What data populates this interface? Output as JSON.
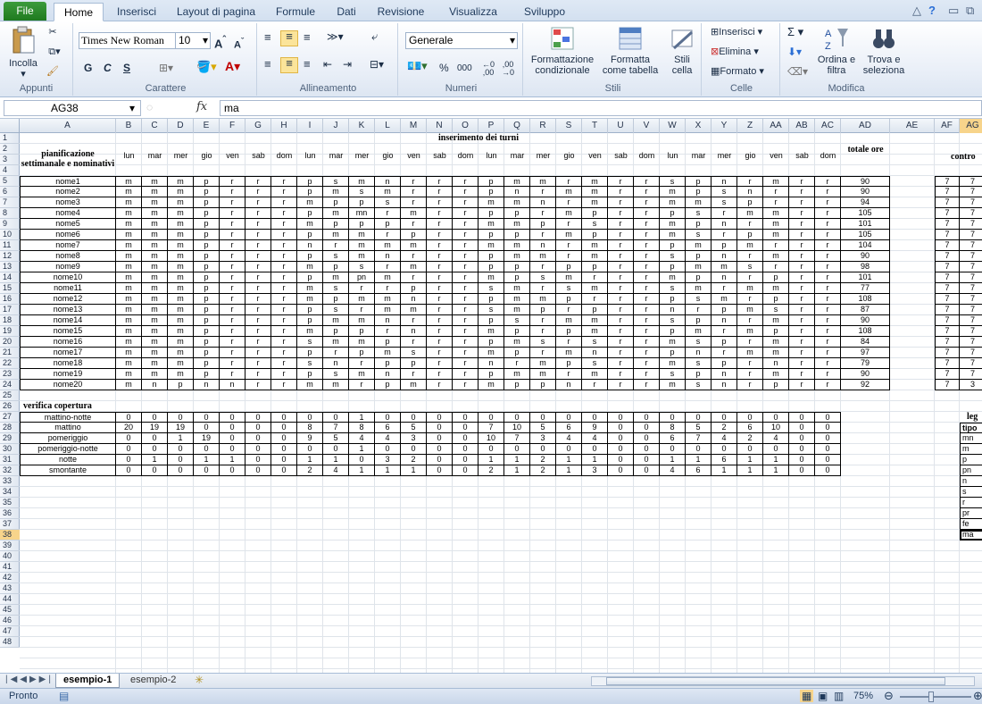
{
  "tabs": [
    "File",
    "Home",
    "Inserisci",
    "Layout di pagina",
    "Formule",
    "Dati",
    "Revisione",
    "Visualizza",
    "Sviluppo"
  ],
  "active_tab": "Home",
  "ribbon": {
    "clipboard": {
      "label": "Appunti",
      "paste": "Incolla"
    },
    "font": {
      "label": "Carattere",
      "family": "Times New Roman",
      "size": "10",
      "bold": "G",
      "italic": "C",
      "underline": "S"
    },
    "alignment": {
      "label": "Allineamento"
    },
    "number": {
      "label": "Numeri",
      "format": "Generale",
      "percent": "%",
      "thousands": "000"
    },
    "styles": {
      "label": "Stili",
      "cond_format": "Formattazione condizionale",
      "table": "Formatta come tabella",
      "cell_styles": "Stili cella"
    },
    "cells": {
      "label": "Celle",
      "insert": "Inserisci",
      "delete": "Elimina",
      "format": "Formato"
    },
    "editing": {
      "label": "Modifica",
      "sort": "Ordina e filtra",
      "find": "Trova e seleziona",
      "sum": "Σ"
    }
  },
  "formula_bar": {
    "name_box": "AG38",
    "fx": "fx",
    "value": "ma"
  },
  "columns": [
    "A",
    "B",
    "C",
    "D",
    "E",
    "F",
    "G",
    "H",
    "I",
    "J",
    "K",
    "L",
    "M",
    "N",
    "O",
    "P",
    "Q",
    "R",
    "S",
    "T",
    "U",
    "V",
    "W",
    "X",
    "Y",
    "Z",
    "AA",
    "AB",
    "AC",
    "AD",
    "AE",
    "AF",
    "AG"
  ],
  "selected_col": "AG",
  "selected_row": 38,
  "row_count": 48,
  "sheet": {
    "top_header": "inserimento dei turni",
    "planning_header": "pianificazione settimanale e nominativi",
    "total_header": "totale ore",
    "control_header": "contro",
    "days": [
      "lun",
      "mar",
      "mer",
      "gio",
      "ven",
      "sab",
      "dom",
      "lun",
      "mar",
      "mer",
      "gio",
      "ven",
      "sab",
      "dom",
      "lun",
      "mar",
      "mer",
      "gio",
      "ven",
      "sab",
      "dom",
      "lun",
      "mar",
      "mer",
      "gio",
      "ven",
      "sab",
      "dom"
    ],
    "people": [
      {
        "name": "nome1",
        "shifts": [
          "m",
          "m",
          "m",
          "p",
          "r",
          "r",
          "r",
          "p",
          "s",
          "m",
          "n",
          "r",
          "r",
          "r",
          "p",
          "m",
          "m",
          "r",
          "m",
          "r",
          "r",
          "s",
          "p",
          "n",
          "r",
          "m",
          "r",
          "r"
        ],
        "total": "90",
        "ctrl": [
          "7",
          "7"
        ]
      },
      {
        "name": "nome2",
        "shifts": [
          "m",
          "m",
          "m",
          "p",
          "r",
          "r",
          "r",
          "p",
          "m",
          "s",
          "m",
          "r",
          "r",
          "r",
          "p",
          "n",
          "r",
          "m",
          "m",
          "r",
          "r",
          "m",
          "p",
          "s",
          "n",
          "r",
          "r",
          "r"
        ],
        "total": "90",
        "ctrl": [
          "7",
          "7"
        ]
      },
      {
        "name": "nome3",
        "shifts": [
          "m",
          "m",
          "m",
          "p",
          "r",
          "r",
          "r",
          "m",
          "p",
          "p",
          "s",
          "r",
          "r",
          "r",
          "m",
          "m",
          "n",
          "r",
          "m",
          "r",
          "r",
          "m",
          "m",
          "s",
          "p",
          "r",
          "r",
          "r"
        ],
        "total": "94",
        "ctrl": [
          "7",
          "7"
        ]
      },
      {
        "name": "nome4",
        "shifts": [
          "m",
          "m",
          "m",
          "p",
          "r",
          "r",
          "r",
          "p",
          "m",
          "mn",
          "r",
          "m",
          "r",
          "r",
          "p",
          "p",
          "r",
          "m",
          "p",
          "r",
          "r",
          "p",
          "s",
          "r",
          "m",
          "m",
          "r",
          "r"
        ],
        "total": "105",
        "ctrl": [
          "7",
          "7"
        ]
      },
      {
        "name": "nome5",
        "shifts": [
          "m",
          "m",
          "m",
          "p",
          "r",
          "r",
          "r",
          "m",
          "p",
          "p",
          "p",
          "r",
          "r",
          "r",
          "m",
          "m",
          "p",
          "r",
          "s",
          "r",
          "r",
          "m",
          "p",
          "n",
          "r",
          "m",
          "r",
          "r"
        ],
        "total": "101",
        "ctrl": [
          "7",
          "7"
        ]
      },
      {
        "name": "nome6",
        "shifts": [
          "m",
          "m",
          "m",
          "p",
          "r",
          "r",
          "r",
          "p",
          "m",
          "m",
          "r",
          "p",
          "r",
          "r",
          "p",
          "p",
          "r",
          "m",
          "p",
          "r",
          "r",
          "m",
          "s",
          "r",
          "p",
          "m",
          "r",
          "r"
        ],
        "total": "105",
        "ctrl": [
          "7",
          "7"
        ]
      },
      {
        "name": "nome7",
        "shifts": [
          "m",
          "m",
          "m",
          "p",
          "r",
          "r",
          "r",
          "n",
          "r",
          "m",
          "m",
          "m",
          "r",
          "r",
          "m",
          "m",
          "n",
          "r",
          "m",
          "r",
          "r",
          "p",
          "m",
          "p",
          "m",
          "r",
          "r",
          "r"
        ],
        "total": "104",
        "ctrl": [
          "7",
          "7"
        ]
      },
      {
        "name": "nome8",
        "shifts": [
          "m",
          "m",
          "m",
          "p",
          "r",
          "r",
          "r",
          "p",
          "s",
          "m",
          "n",
          "r",
          "r",
          "r",
          "p",
          "m",
          "m",
          "r",
          "m",
          "r",
          "r",
          "s",
          "p",
          "n",
          "r",
          "m",
          "r",
          "r"
        ],
        "total": "90",
        "ctrl": [
          "7",
          "7"
        ]
      },
      {
        "name": "nome9",
        "shifts": [
          "m",
          "m",
          "m",
          "p",
          "r",
          "r",
          "r",
          "m",
          "p",
          "s",
          "r",
          "m",
          "r",
          "r",
          "p",
          "p",
          "r",
          "p",
          "p",
          "r",
          "r",
          "p",
          "m",
          "m",
          "s",
          "r",
          "r",
          "r"
        ],
        "total": "98",
        "ctrl": [
          "7",
          "7"
        ]
      },
      {
        "name": "nome10",
        "shifts": [
          "m",
          "m",
          "m",
          "p",
          "r",
          "r",
          "r",
          "p",
          "m",
          "pn",
          "m",
          "r",
          "r",
          "r",
          "m",
          "p",
          "s",
          "m",
          "r",
          "r",
          "r",
          "m",
          "p",
          "n",
          "r",
          "p",
          "r",
          "r"
        ],
        "total": "101",
        "ctrl": [
          "7",
          "7"
        ]
      },
      {
        "name": "nome11",
        "shifts": [
          "m",
          "m",
          "m",
          "p",
          "r",
          "r",
          "r",
          "m",
          "s",
          "r",
          "r",
          "p",
          "r",
          "r",
          "s",
          "m",
          "r",
          "s",
          "m",
          "r",
          "r",
          "s",
          "m",
          "r",
          "m",
          "m",
          "r",
          "r"
        ],
        "total": "77",
        "ctrl": [
          "7",
          "7"
        ]
      },
      {
        "name": "nome12",
        "shifts": [
          "m",
          "m",
          "m",
          "p",
          "r",
          "r",
          "r",
          "m",
          "p",
          "m",
          "m",
          "n",
          "r",
          "r",
          "p",
          "m",
          "m",
          "p",
          "r",
          "r",
          "r",
          "p",
          "s",
          "m",
          "r",
          "p",
          "r",
          "r"
        ],
        "total": "108",
        "ctrl": [
          "7",
          "7"
        ]
      },
      {
        "name": "nome13",
        "shifts": [
          "m",
          "m",
          "m",
          "p",
          "r",
          "r",
          "r",
          "p",
          "s",
          "r",
          "m",
          "m",
          "r",
          "r",
          "s",
          "m",
          "p",
          "r",
          "p",
          "r",
          "r",
          "n",
          "r",
          "p",
          "m",
          "s",
          "r",
          "r"
        ],
        "total": "87",
        "ctrl": [
          "7",
          "7"
        ]
      },
      {
        "name": "nome14",
        "shifts": [
          "m",
          "m",
          "m",
          "p",
          "r",
          "r",
          "r",
          "p",
          "m",
          "m",
          "n",
          "r",
          "r",
          "r",
          "p",
          "s",
          "r",
          "m",
          "m",
          "r",
          "r",
          "s",
          "p",
          "n",
          "r",
          "m",
          "r",
          "r"
        ],
        "total": "90",
        "ctrl": [
          "7",
          "7"
        ]
      },
      {
        "name": "nome15",
        "shifts": [
          "m",
          "m",
          "m",
          "p",
          "r",
          "r",
          "r",
          "m",
          "p",
          "p",
          "r",
          "n",
          "r",
          "r",
          "m",
          "p",
          "r",
          "p",
          "m",
          "r",
          "r",
          "p",
          "m",
          "r",
          "m",
          "p",
          "r",
          "r"
        ],
        "total": "108",
        "ctrl": [
          "7",
          "7"
        ]
      },
      {
        "name": "nome16",
        "shifts": [
          "m",
          "m",
          "m",
          "p",
          "r",
          "r",
          "r",
          "s",
          "m",
          "m",
          "p",
          "r",
          "r",
          "r",
          "p",
          "m",
          "s",
          "r",
          "s",
          "r",
          "r",
          "m",
          "s",
          "p",
          "r",
          "m",
          "r",
          "r"
        ],
        "total": "84",
        "ctrl": [
          "7",
          "7"
        ]
      },
      {
        "name": "nome17",
        "shifts": [
          "m",
          "m",
          "m",
          "p",
          "r",
          "r",
          "r",
          "p",
          "r",
          "p",
          "m",
          "s",
          "r",
          "r",
          "m",
          "p",
          "r",
          "m",
          "n",
          "r",
          "r",
          "p",
          "n",
          "r",
          "m",
          "m",
          "r",
          "r"
        ],
        "total": "97",
        "ctrl": [
          "7",
          "7"
        ]
      },
      {
        "name": "nome18",
        "shifts": [
          "m",
          "m",
          "m",
          "p",
          "r",
          "r",
          "r",
          "s",
          "n",
          "r",
          "p",
          "p",
          "r",
          "r",
          "n",
          "r",
          "m",
          "p",
          "s",
          "r",
          "r",
          "m",
          "s",
          "p",
          "r",
          "n",
          "r",
          "r"
        ],
        "total": "79",
        "ctrl": [
          "7",
          "7"
        ]
      },
      {
        "name": "nome19",
        "shifts": [
          "m",
          "m",
          "m",
          "p",
          "r",
          "r",
          "r",
          "p",
          "s",
          "m",
          "n",
          "r",
          "r",
          "r",
          "p",
          "m",
          "m",
          "r",
          "m",
          "r",
          "r",
          "s",
          "p",
          "n",
          "r",
          "m",
          "r",
          "r"
        ],
        "total": "90",
        "ctrl": [
          "7",
          "7"
        ]
      },
      {
        "name": "nome20",
        "shifts": [
          "m",
          "n",
          "p",
          "n",
          "n",
          "r",
          "r",
          "m",
          "m",
          "r",
          "p",
          "m",
          "r",
          "r",
          "m",
          "p",
          "p",
          "n",
          "r",
          "r",
          "r",
          "m",
          "s",
          "n",
          "r",
          "p",
          "r",
          "r"
        ],
        "total": "92",
        "ctrl": [
          "7",
          "3"
        ]
      }
    ],
    "coverage_header": "verifica copertura",
    "coverage": [
      {
        "label": "mattino-notte",
        "values": [
          "0",
          "0",
          "0",
          "0",
          "0",
          "0",
          "0",
          "0",
          "0",
          "1",
          "0",
          "0",
          "0",
          "0",
          "0",
          "0",
          "0",
          "0",
          "0",
          "0",
          "0",
          "0",
          "0",
          "0",
          "0",
          "0",
          "0",
          "0"
        ]
      },
      {
        "label": "mattino",
        "values": [
          "20",
          "19",
          "19",
          "0",
          "0",
          "0",
          "0",
          "8",
          "7",
          "8",
          "6",
          "5",
          "0",
          "0",
          "7",
          "10",
          "5",
          "6",
          "9",
          "0",
          "0",
          "8",
          "5",
          "2",
          "6",
          "10",
          "0",
          "0"
        ]
      },
      {
        "label": "pomeriggio",
        "values": [
          "0",
          "0",
          "1",
          "19",
          "0",
          "0",
          "0",
          "9",
          "5",
          "4",
          "4",
          "3",
          "0",
          "0",
          "10",
          "7",
          "3",
          "4",
          "4",
          "0",
          "0",
          "6",
          "7",
          "4",
          "2",
          "4",
          "0",
          "0"
        ]
      },
      {
        "label": "pomeriggio-notte",
        "values": [
          "0",
          "0",
          "0",
          "0",
          "0",
          "0",
          "0",
          "0",
          "0",
          "1",
          "0",
          "0",
          "0",
          "0",
          "0",
          "0",
          "0",
          "0",
          "0",
          "0",
          "0",
          "0",
          "0",
          "0",
          "0",
          "0",
          "0",
          "0"
        ]
      },
      {
        "label": "notte",
        "values": [
          "0",
          "1",
          "0",
          "1",
          "1",
          "0",
          "0",
          "1",
          "1",
          "0",
          "3",
          "2",
          "0",
          "0",
          "1",
          "1",
          "2",
          "1",
          "1",
          "0",
          "0",
          "1",
          "1",
          "6",
          "1",
          "1",
          "0",
          "0"
        ]
      },
      {
        "label": "smontante",
        "values": [
          "0",
          "0",
          "0",
          "0",
          "0",
          "0",
          "0",
          "2",
          "4",
          "1",
          "1",
          "1",
          "0",
          "0",
          "2",
          "1",
          "2",
          "1",
          "3",
          "0",
          "0",
          "4",
          "6",
          "1",
          "1",
          "1",
          "0",
          "0"
        ]
      }
    ],
    "legend_header": "leg",
    "legend_sub": "tipo",
    "legend": [
      "mn",
      "m",
      "p",
      "pn",
      "n",
      "s",
      "r",
      "pr",
      "fe",
      "ma"
    ]
  },
  "sheet_tabs": [
    "esempio-1",
    "esempio-2"
  ],
  "active_sheet": "esempio-1",
  "status": {
    "mode": "Pronto",
    "zoom": "75%"
  }
}
